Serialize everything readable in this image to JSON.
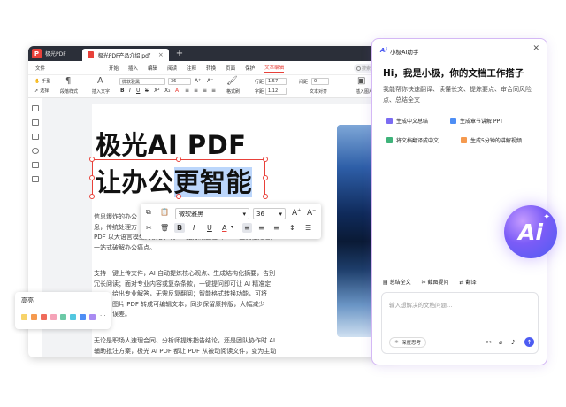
{
  "editor": {
    "app_name": "极光PDF",
    "doc_tab": "极光PDF产品介绍.pdf",
    "menus": [
      "文件",
      "开始",
      "插入",
      "编辑",
      "阅读",
      "注释",
      "转换",
      "页面",
      "保护",
      "文本编辑"
    ],
    "active_menu": "文本编辑",
    "search_placeholder": "搜索",
    "toolbar": {
      "hand": "手型",
      "select": "选择",
      "paragraph_style": "段落样式",
      "insert_text": "插入文字",
      "font": "微软雅黑",
      "size": "36",
      "line_height_label": "行距",
      "line_height_value": "1.57",
      "word_spacing_label": "字距",
      "word_spacing_value": "1.12",
      "spacing_label": "间距",
      "spacing_value": "0",
      "format_painter": "格式刷",
      "text_align": "文本对齐",
      "insert_image": "插入图片",
      "toolbar_more": "插入"
    }
  },
  "document": {
    "title_line1": "极光AI PDF",
    "title_line2_plain": "让办公",
    "title_line2_selected": "更智能",
    "para1": [
      "信息爆炸的办公",
      "息，传统处理方",
      "PDF 以大语言模型为核心，将 AI 能力深度融入 PDF 全流程处理，",
      "一站式破解办公痛点。"
    ],
    "para2": [
      "支持一键上传文件，AI 自动提炼核心观点、生成结构化摘要，告别",
      "冗长阅读；面对专业内容或复杂条款，一键提问即可让 AI 精准定",
      "给出专业解答，无需反复翻阅；智能格式转换功能，可将",
      "图片 PDF 转成可编辑文本，同步保留原排版，大幅减少",
      "误差。"
    ],
    "para3": [
      "无论是职场人速理合同、分析师提炼指告结论，还是团队协作时 AI",
      "辅助批注方案，极光 AI PDF 都让 PDF 从被动阅读文件，变为主动"
    ]
  },
  "format_bar": {
    "font": "微软雅黑",
    "size": "36"
  },
  "highlight_palette": {
    "label": "高亮",
    "colors": [
      "#f7d36a",
      "#f59a4f",
      "#ef6b5b",
      "#f5a3b8",
      "#6cc9a6",
      "#52c7e0",
      "#4e8ef5",
      "#a98bf2"
    ],
    "more": "···"
  },
  "ai_panel": {
    "logo": "Ai",
    "title": "小极AI助手",
    "greeting": "Hi，我是小极，你的文档工作搭子",
    "description": "我能帮你快速翻译、读懂长文、提炼要点、审合同风险点、总结全文",
    "chips": [
      {
        "label": "生成中文总结",
        "color": "#7b6cf2"
      },
      {
        "label": "生成章节讲解 PPT",
        "color": "#4e8ef5"
      },
      {
        "label": "将文档翻译成中文",
        "color": "#3fb37a"
      },
      {
        "label": "生成5分钟的讲解视频",
        "color": "#f59a4f"
      }
    ],
    "badge": "Ai",
    "actions": [
      "总结全文",
      "截图提问",
      "翻译"
    ],
    "input_placeholder": "输入想解决的文档问题…",
    "deep_think": "深度思考"
  }
}
